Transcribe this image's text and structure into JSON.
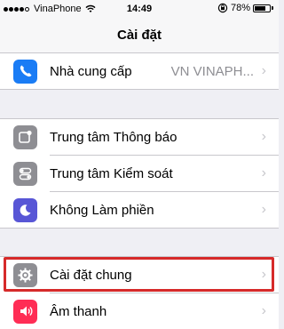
{
  "status_bar": {
    "carrier": "VinaPhone",
    "time": "14:49",
    "battery": "78%",
    "battery_level": 0.78,
    "signal_bars_filled": 4
  },
  "nav": {
    "title": "Cài đặt"
  },
  "sections": [
    {
      "rows": [
        {
          "label": "Nhà cung cấp",
          "value": "VN VINAPH...",
          "icon": "phone-icon",
          "color": "#1a7cf5"
        }
      ]
    },
    {
      "rows": [
        {
          "label": "Trung tâm Thông báo",
          "icon": "notification-center-icon",
          "color": "#8e8e93"
        },
        {
          "label": "Trung tâm Kiểm soát",
          "icon": "control-center-icon",
          "color": "#8e8e93"
        },
        {
          "label": "Không Làm phiền",
          "icon": "moon-icon",
          "color": "#5856d6"
        }
      ]
    },
    {
      "rows": [
        {
          "label": "Cài đặt chung",
          "icon": "gear-icon",
          "color": "#8e8e93",
          "highlighted": true
        },
        {
          "label": "Âm thanh",
          "icon": "speaker-icon",
          "color": "#ff2d55"
        }
      ]
    }
  ],
  "colors": {
    "highlight_border": "#d62a2a",
    "background": "#efeff4"
  }
}
